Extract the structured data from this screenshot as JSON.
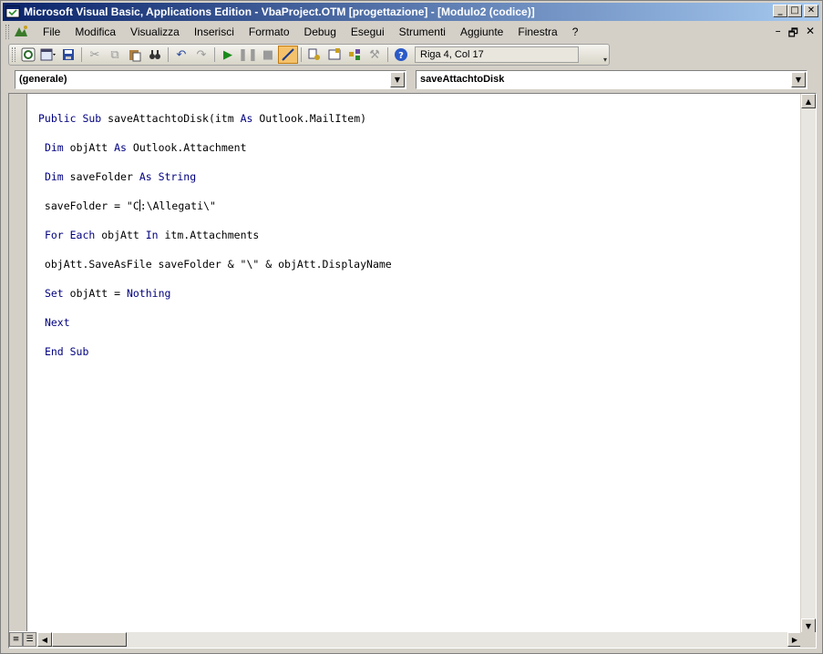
{
  "window": {
    "title": "Microsoft Visual Basic, Applications Edition - VbaProject.OTM [progettazione] - [Modulo2 (codice)]",
    "buttons": {
      "minimize": "_",
      "restore": "□",
      "close": "✕"
    }
  },
  "menu": {
    "items": [
      {
        "label": "File"
      },
      {
        "label": "Modifica"
      },
      {
        "label": "Visualizza"
      },
      {
        "label": "Inserisci"
      },
      {
        "label": "Formato"
      },
      {
        "label": "Debug"
      },
      {
        "label": "Esegui"
      },
      {
        "label": "Strumenti"
      },
      {
        "label": "Aggiunte"
      },
      {
        "label": "Finestra"
      },
      {
        "label": "?"
      }
    ],
    "mdi": {
      "minimize": "–",
      "restore": "🗗",
      "close": "✕"
    }
  },
  "toolbar": {
    "position": "Riga 4, Col 17",
    "icons": [
      "outlook-icon",
      "insert-module-icon",
      "save-icon",
      "cut-icon",
      "copy-icon",
      "paste-icon",
      "find-icon",
      "undo-icon",
      "redo-icon",
      "run-icon",
      "break-icon",
      "reset-icon",
      "design-mode-icon",
      "project-explorer-icon",
      "properties-icon",
      "object-browser-icon",
      "toolbox-icon",
      "help-icon"
    ]
  },
  "combos": {
    "object": "(generale)",
    "procedure": "saveAttachtoDisk"
  },
  "code": {
    "lines": [
      "Public Sub saveAttachtoDisk(itm As Outlook.MailItem)",
      " Dim objAtt As Outlook.Attachment",
      " Dim saveFolder As String",
      " saveFolder = \"C:\\Allegati\\\"",
      " For Each objAtt In itm.Attachments",
      " objAtt.SaveAsFile saveFolder & \"\\\" & objAtt.DisplayName",
      " Set objAtt = Nothing",
      " Next",
      " End Sub"
    ],
    "keyword_color": "#00007f"
  },
  "colors": {
    "title_start": "#0a246a",
    "title_end": "#a6caf0",
    "chrome": "#d4d0c8"
  }
}
